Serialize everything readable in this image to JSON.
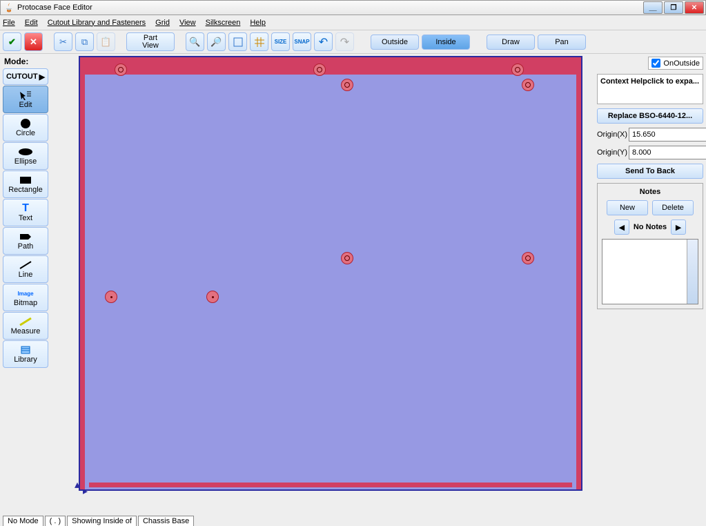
{
  "title": "Protocase Face Editor",
  "menu": [
    "File",
    "Edit",
    "Cutout Library and Fasteners",
    "Grid",
    "View",
    "Silkscreen",
    "Help"
  ],
  "toolbar": {
    "partview": "Part\nView",
    "outside": "Outside",
    "inside": "Inside",
    "draw": "Draw",
    "pan": "Pan"
  },
  "mode": {
    "label": "Mode:",
    "cutout": "CUTOUT",
    "items": [
      "Edit",
      "Circle",
      "Ellipse",
      "Rectangle",
      "Text",
      "Path",
      "Line",
      "Bitmap",
      "Measure",
      "Library"
    ]
  },
  "right": {
    "onoutside": "OnOutside",
    "context": "Context Helpclick to expa...",
    "replace": "Replace BSO-6440-12...",
    "originx_label": "Origin(X)",
    "originx_value": "15.650",
    "originy_label": "Origin(Y)",
    "originy_value": "8.000",
    "sendback": "Send To Back",
    "notes_title": "Notes",
    "new": "New",
    "delete": "Delete",
    "nonotes": "No Notes"
  },
  "status": {
    "nomode": "No Mode",
    "dot": "( . )",
    "showing": "Showing Inside of",
    "chassis": "Chassis Base"
  }
}
